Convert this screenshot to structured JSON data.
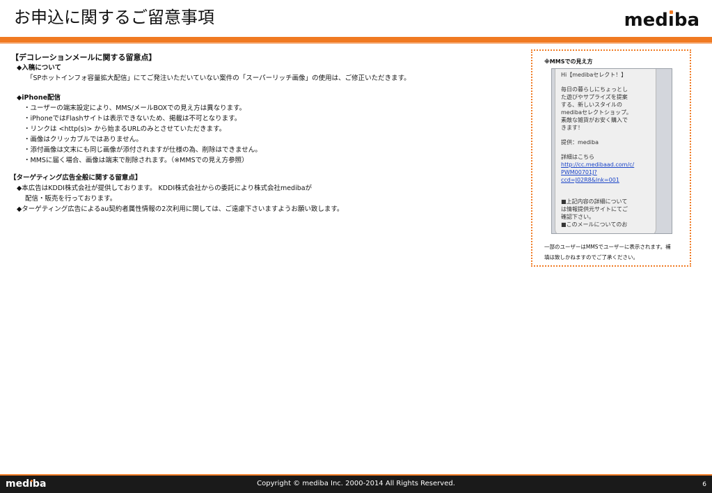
{
  "header": {
    "title": "お申込に関するご留意事項",
    "logo_pre": "med",
    "logo_i": "ı",
    "logo_post": "ba"
  },
  "section1": {
    "title": "【デコレーションメールに関する留意点】",
    "sub1_title": "◆入稿について",
    "sub1_lines": [
      "「SPホットインフォ容量拡大配信」にてご発注いただいていない案件の「スーパーリッチ画像」の使用は、ご修正いただきます。"
    ],
    "sub2_title": "◆iPhone配信",
    "sub2_lines": [
      "・ユーザーの端末設定により、MMS/メールBOXでの見え方は異なります。",
      "・iPhoneではFlashサイトは表示できないため、掲載は不可となります。",
      "・リンクは <http(s)> から始まるURLのみとさせていただきます。",
      "・画像はクリッカブルではありません。",
      "・添付画像は文末にも同じ画像が添付されますが仕様の為、削除はできません。",
      "・MMSに届く場合、画像は端末で削除されます。（※MMSでの見え方参照）"
    ]
  },
  "section2": {
    "title": "【ターゲティング広告全般に関する留意点】",
    "lines": [
      "◆本広告はKDDI株式会社が提供しております。 KDDI株式会社からの委託により株式会社medibaが",
      "配信・販売を行っております。",
      "◆ターゲティング広告によるau契約者属性情報の2次利用に関しては、ご遠慮下さいますようお願い致します。"
    ]
  },
  "side": {
    "label": "※MMSでの見え方",
    "msg_header": "Hi【medibaセレクト！】",
    "msg_body": [
      "毎日の暮らしにちょっとし",
      "た遊びやサプライズを提案",
      "する、新しいスタイルの",
      "medibaセレクトショップ。",
      "素敵な雑貨がお安く購入で",
      "きます！"
    ],
    "msg_provider": "提供：mediba",
    "msg_detail": "詳細はこちら",
    "msg_link": [
      "http://cc.medibaad.com/c/",
      "PWM00701J?",
      "ccd=J02R8&lnk=001"
    ],
    "msg_note": [
      "■上記内容の詳細について",
      "は情報提供元サイトにてご",
      "確認下さい。",
      "■このメールについてのお"
    ],
    "caption": [
      "一部のユーザーはMMSでユーザーに表示されます。補",
      "填は致しかねますのでご了承ください。"
    ]
  },
  "footer": {
    "logo_pre": "med",
    "logo_i": "ı",
    "logo_post": "ba",
    "copyright": "Copyright © mediba Inc. 2000-2014 All Rights Reserved.",
    "page_number": "6"
  },
  "colors": {
    "accent": "#f07a22",
    "link": "#1a44c8",
    "footer_bg": "#1a1a1a"
  }
}
